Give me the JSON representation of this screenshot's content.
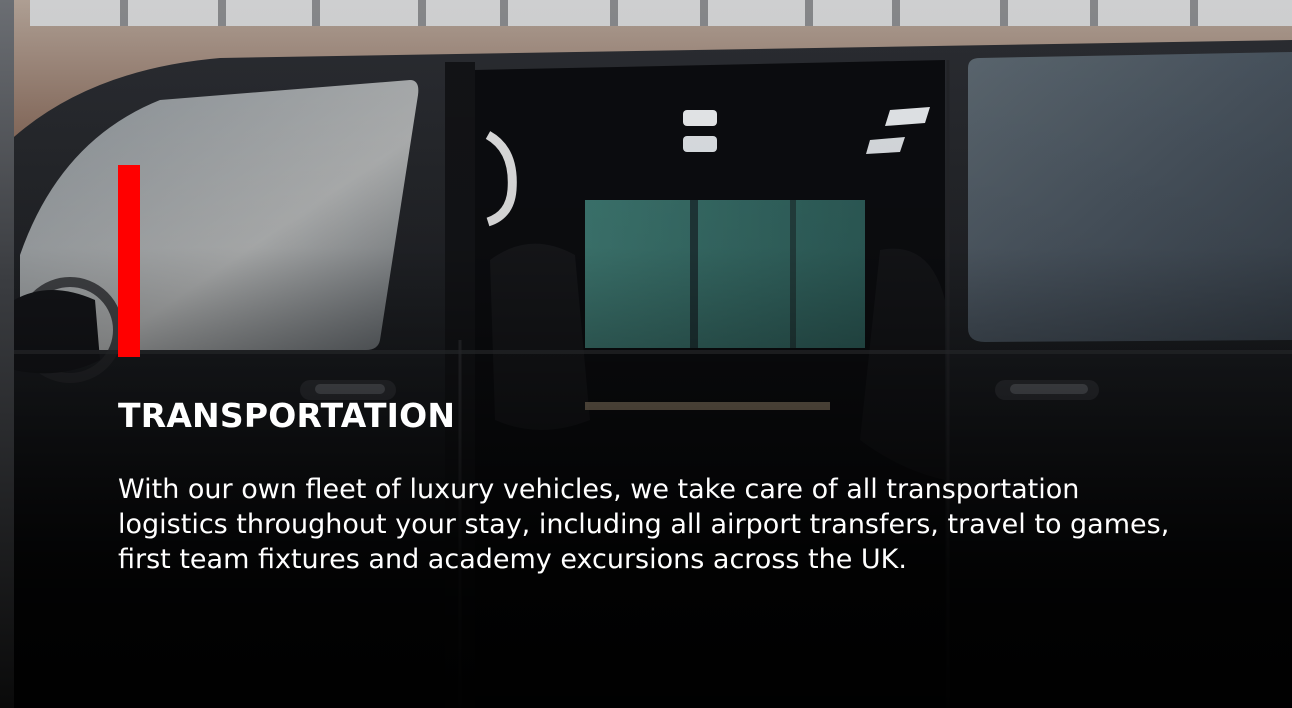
{
  "section": {
    "title": "TRANSPORTATION",
    "body": "With our own fleet of luxury vehicles, we take care of all transportation logistics throughout your stay, including all airport transfers, travel to games, first team fixtures and academy excursions across the UK."
  },
  "colors": {
    "accent": "#ff0000",
    "text": "#ffffff",
    "background": "#0c0d10"
  },
  "media": {
    "background_image": "black-luxury-van-sliding-door-open"
  }
}
